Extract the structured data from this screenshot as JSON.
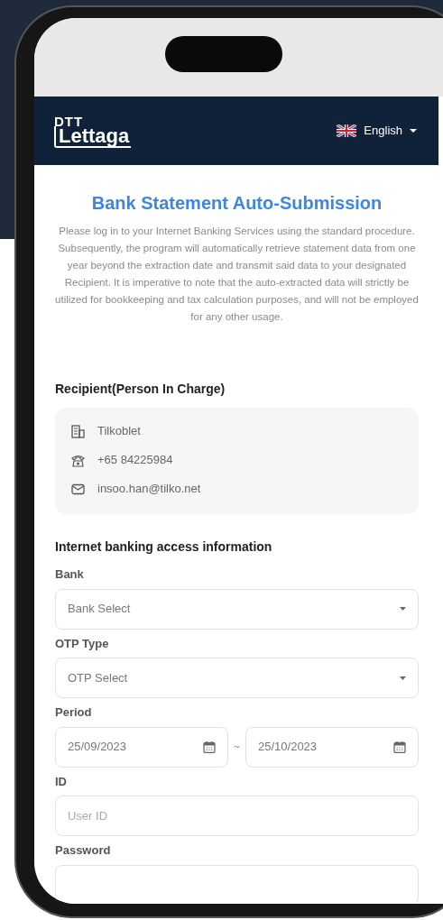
{
  "header": {
    "logo_top": "DTT",
    "logo_bottom": "Lettaga",
    "language": "English"
  },
  "title": "Bank Statement Auto-Submission",
  "description": "Please log in to your Internet Banking Services using the standard procedure. Subsequently, the program will automatically retrieve statement data from one year beyond the extraction date and transmit said data to your designated Recipient. It is imperative to note that the auto-extracted data will strictly be utilized for bookkeeping and tax calculation purposes, and will not be employed for any other usage.",
  "recipient": {
    "heading": "Recipient(Person In Charge)",
    "items": [
      {
        "kind": "company",
        "text": "Tilkoblet"
      },
      {
        "kind": "phone",
        "text": "+65 84225984"
      },
      {
        "kind": "email",
        "text": "insoo.han@tilko.net"
      }
    ]
  },
  "form": {
    "heading": "Internet banking access information",
    "fields": [
      {
        "kind": "select",
        "label": "Bank",
        "placeholder": "Bank Select"
      },
      {
        "kind": "select",
        "label": "OTP Type",
        "placeholder": "OTP Select"
      },
      {
        "kind": "date_range",
        "label": "Period",
        "from": "25/09/2023",
        "separator": "~",
        "to": "25/10/2023"
      },
      {
        "kind": "text",
        "label": "ID",
        "placeholder": "User ID"
      },
      {
        "kind": "password",
        "label": "Password"
      }
    ]
  }
}
